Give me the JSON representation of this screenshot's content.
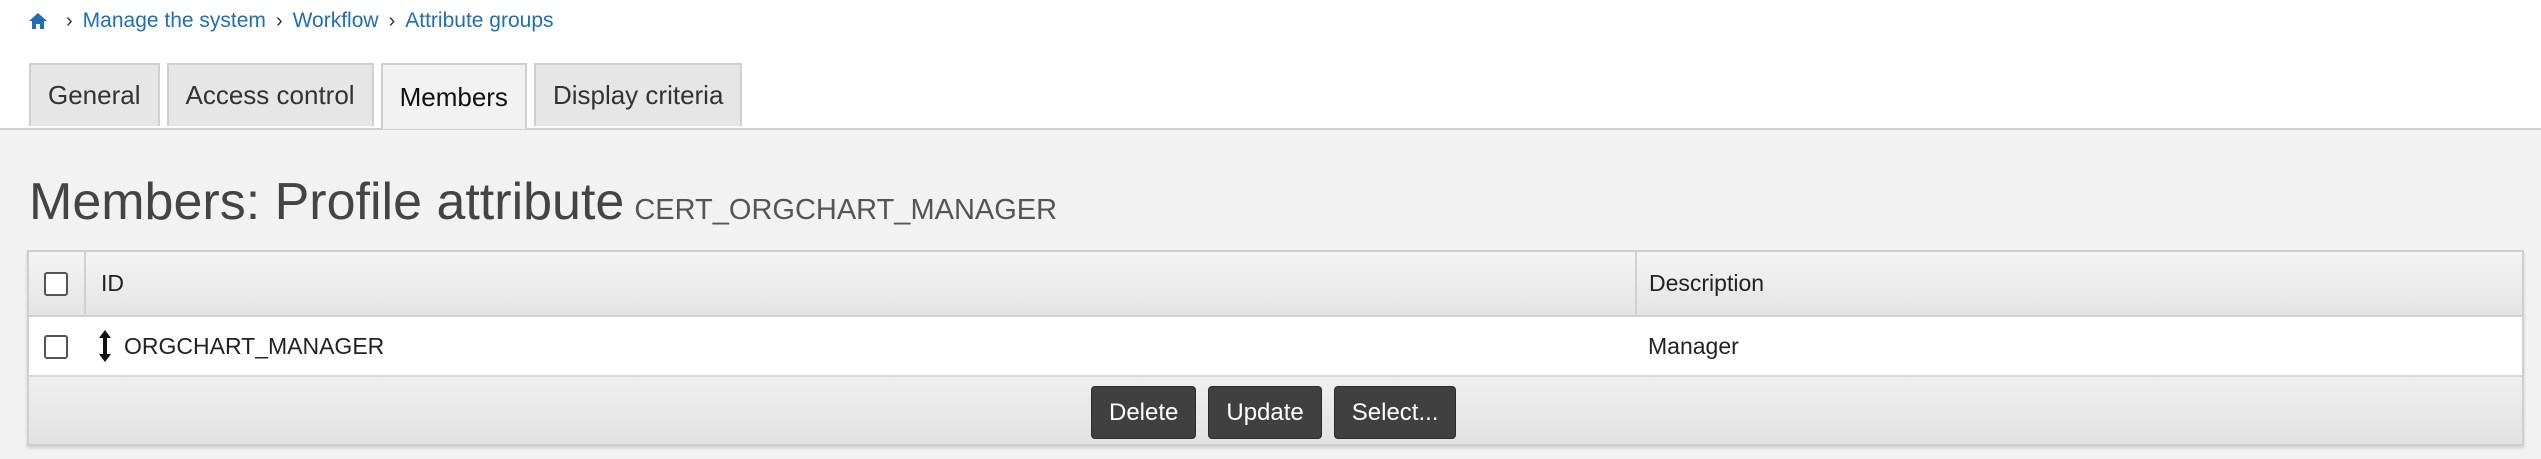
{
  "breadcrumb": {
    "home_icon": "home-icon",
    "items": [
      "Manage the system",
      "Workflow",
      "Attribute groups"
    ],
    "separator": "›"
  },
  "tabs": [
    {
      "label": "General",
      "active": false
    },
    {
      "label": "Access control",
      "active": false
    },
    {
      "label": "Members",
      "active": true
    },
    {
      "label": "Display criteria",
      "active": false
    }
  ],
  "page": {
    "title": "Members: Profile attribute",
    "subtitle": "CERT_ORGCHART_MANAGER"
  },
  "table": {
    "columns": [
      "ID",
      "Description"
    ],
    "rows": [
      {
        "id": "ORGCHART_MANAGER",
        "description": "Manager",
        "drag_icon": "drag-vertical-icon"
      }
    ]
  },
  "actions": {
    "delete_label": "Delete",
    "update_label": "Update",
    "select_label": "Select..."
  },
  "colors": {
    "link": "#1f6fb2",
    "button_bg": "#404040",
    "page_bg": "#f2f2f2"
  }
}
